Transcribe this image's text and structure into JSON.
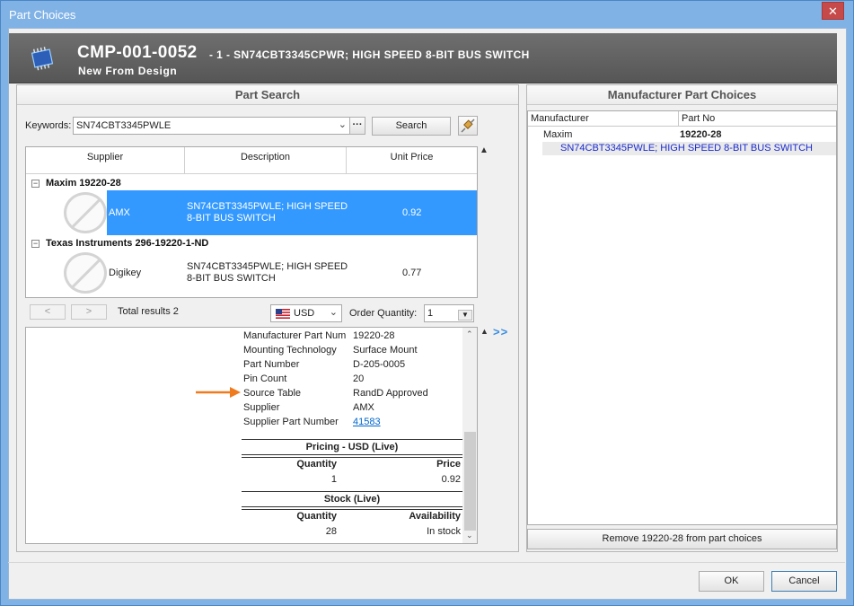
{
  "window": {
    "title": "Part Choices",
    "close_glyph": "✕"
  },
  "header": {
    "code": "CMP-001-0052",
    "description": "- 1 - SN74CBT3345CPWR; HIGH SPEED 8-BIT BUS SWITCH",
    "subtitle": "New From Design",
    "icon": "chip-icon"
  },
  "part_search": {
    "title": "Part Search",
    "keywords_label": "Keywords:",
    "keywords_value": "SN74CBT3345PWLE",
    "more_glyph": "···",
    "search_label": "Search",
    "columns": [
      "Supplier",
      "Description",
      "Unit Price"
    ],
    "groups": [
      {
        "name": "Maxim 19220-28",
        "rows": [
          {
            "supplier": "AMX",
            "description_1": "SN74CBT3345PWLE; HIGH SPEED",
            "description_2": "8-BIT BUS SWITCH",
            "price": "0.92",
            "selected": true
          }
        ]
      },
      {
        "name": "Texas Instruments 296-19220-1-ND",
        "rows": [
          {
            "supplier": "Digikey",
            "description_1": "SN74CBT3345PWLE; HIGH SPEED",
            "description_2": "8-BIT BUS SWITCH",
            "price": "0.77",
            "selected": false
          }
        ]
      }
    ],
    "prev_glyph": "<",
    "next_glyph": ">",
    "total_results": "Total results 2",
    "currency": "USD",
    "order_quantity_label": "Order Quantity:",
    "order_quantity_value": "1",
    "expand_glyph": ">>"
  },
  "details": {
    "properties": [
      {
        "name": "Manufacturer Part Num",
        "value": "19220-28"
      },
      {
        "name": "Mounting Technology",
        "value": "Surface Mount"
      },
      {
        "name": "Part Number",
        "value": "D-205-0005"
      },
      {
        "name": "Pin Count",
        "value": "20"
      },
      {
        "name": "Source Table",
        "value": "RandD Approved"
      },
      {
        "name": "Supplier",
        "value": "AMX"
      },
      {
        "name": "Supplier Part Number",
        "value": "41583"
      }
    ],
    "pricing_title": "Pricing - USD (Live)",
    "pricing_qty_header": "Quantity",
    "pricing_price_header": "Price",
    "pricing_rows": [
      {
        "qty": "1",
        "price": "0.92"
      }
    ],
    "stock_title": "Stock (Live)",
    "stock_qty_header": "Quantity",
    "stock_avail_header": "Availability",
    "stock_rows": [
      {
        "qty": "28",
        "availability": "In stock"
      }
    ]
  },
  "mpc": {
    "title": "Manufacturer Part Choices",
    "columns": [
      "Manufacturer",
      "Part No"
    ],
    "manufacturer": "Maxim",
    "part_no": "19220-28",
    "description": "SN74CBT3345PWLE; HIGH SPEED 8-BIT BUS SWITCH",
    "remove_label": "Remove 19220-28 from part choices"
  },
  "footer": {
    "ok_label": "OK",
    "cancel_label": "Cancel"
  },
  "colors": {
    "selection": "#3399ff",
    "accent_arrow": "#f07a1e",
    "link": "#0066cc"
  }
}
